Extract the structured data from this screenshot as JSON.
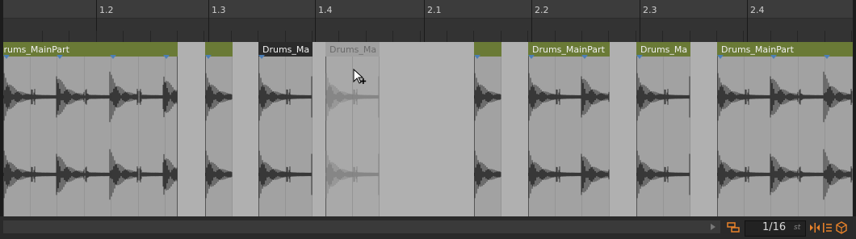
{
  "ruler": {
    "bar_labels": [
      "1.2",
      "1.3",
      "1.4",
      "2.1",
      "2.2",
      "2.3",
      "2.4"
    ]
  },
  "clips": [
    {
      "name": "Drums_MainPart",
      "style": "green"
    },
    {
      "name": "",
      "style": "green"
    },
    {
      "name": "Drums_Ma",
      "style": "selected"
    },
    {
      "name": "Drums_Ma",
      "style": "ghost"
    },
    {
      "name": "",
      "style": "green"
    },
    {
      "name": "Drums_MainPart",
      "style": "green"
    },
    {
      "name": "Drums_Ma",
      "style": "green"
    },
    {
      "name": "Drums_MainPart",
      "style": "green"
    }
  ],
  "footer": {
    "grid_value": "1/16",
    "grid_unit": "st"
  },
  "colors": {
    "clip_header": "#6a7a36",
    "accent": "#e8822a",
    "warp_marker": "#4d7fb6"
  },
  "icons": {
    "grid": "grid-quantize-icon",
    "cursor": "pointer-plus-icon"
  }
}
